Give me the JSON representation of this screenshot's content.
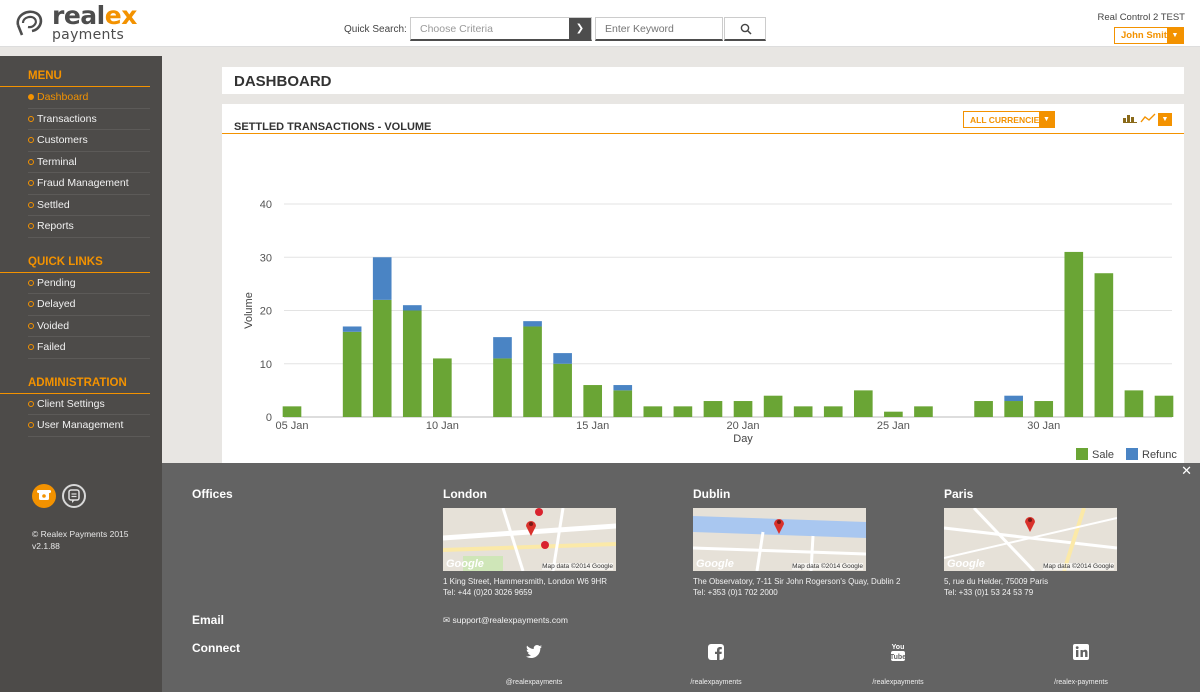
{
  "header": {
    "logo_main": "real",
    "logo_accent": "ex",
    "logo_sub": "payments",
    "quick_search_label": "Quick Search:",
    "criteria_placeholder": "Choose Criteria",
    "keyword_placeholder": "Enter Keyword",
    "account_name": "Real Control 2 TEST",
    "user_name": "John Smith"
  },
  "sidebar": {
    "sections": [
      {
        "heading": "MENU",
        "items": [
          "Dashboard",
          "Transactions",
          "Customers",
          "Terminal",
          "Fraud Management",
          "Settled",
          "Reports"
        ],
        "active": "Dashboard"
      },
      {
        "heading": "QUICK LINKS",
        "items": [
          "Pending",
          "Delayed",
          "Voided",
          "Failed"
        ]
      },
      {
        "heading": "ADMINISTRATION",
        "items": [
          "Client Settings",
          "User Management"
        ]
      }
    ],
    "copyright": "© Realex Payments 2015",
    "version": "v2.1.88"
  },
  "dashboard": {
    "title": "DASHBOARD",
    "chart_title": "SETTLED TRANSACTIONS - VOLUME",
    "currency_label": "ALL CURRENCIES"
  },
  "chart_data": {
    "type": "bar",
    "stacked": true,
    "xlabel": "Day",
    "ylabel": "Volume",
    "ylim": [
      0,
      40
    ],
    "yticks": [
      0,
      10,
      20,
      30,
      40
    ],
    "x": [
      5,
      6,
      7,
      8,
      9,
      10,
      11,
      12,
      13,
      14,
      15,
      16,
      17,
      18,
      19,
      20,
      21,
      22,
      23,
      24,
      25,
      26,
      27,
      28,
      29,
      30,
      31,
      32,
      33,
      34
    ],
    "xticks": [
      5,
      10,
      15,
      20,
      25,
      30
    ],
    "xticklabels": [
      "05 Jan",
      "10 Jan",
      "15 Jan",
      "20 Jan",
      "25 Jan",
      "30 Jan"
    ],
    "series": [
      {
        "name": "Sale",
        "color": "#6aa535",
        "values": [
          2,
          0,
          16,
          22,
          20,
          11,
          0,
          11,
          17,
          10,
          6,
          5,
          2,
          2,
          3,
          3,
          4,
          2,
          2,
          5,
          1,
          2,
          0,
          3,
          3,
          3,
          31,
          27,
          5,
          4
        ]
      },
      {
        "name": "Refunc",
        "color": "#4a84c4",
        "values": [
          0,
          0,
          1,
          8,
          1,
          0,
          0,
          4,
          1,
          2,
          0,
          1,
          0,
          0,
          0,
          0,
          0,
          0,
          0,
          0,
          0,
          0,
          0,
          0,
          1,
          0,
          0,
          0,
          0,
          0
        ]
      }
    ],
    "grid": true,
    "legend_position": "bottom-right"
  },
  "footer": {
    "offices_label": "Offices",
    "offices": [
      {
        "city": "London",
        "address": "1 King Street, Hammersmith, London W6 9HR",
        "tel": "Tel: +44 (0)20 3026 9659",
        "map_credit": "Map data ©2014 Google"
      },
      {
        "city": "Dublin",
        "address": "The Observatory, 7-11 Sir John Rogerson's Quay, Dublin 2",
        "tel": "Tel: +353 (0)1 702 2000",
        "map_credit": "Map data ©2014 Google"
      },
      {
        "city": "Paris",
        "address": "5, rue du Helder, 75009 Paris",
        "tel": "Tel: +33 (0)1 53 24 53 79",
        "map_credit": "Map data ©2014 Google"
      }
    ],
    "email_label": "Email",
    "email": "support@realexpayments.com",
    "connect_label": "Connect",
    "social": [
      {
        "icon": "twitter-icon",
        "handle": "@realexpayments"
      },
      {
        "icon": "facebook-icon",
        "handle": "/realexpayments"
      },
      {
        "icon": "youtube-icon",
        "handle": "/realexpayments"
      },
      {
        "icon": "linkedin-icon",
        "handle": "/realex-payments"
      }
    ]
  },
  "colors": {
    "accent": "#f39200",
    "sidebar": "#4d4b49",
    "footer": "#636363"
  }
}
